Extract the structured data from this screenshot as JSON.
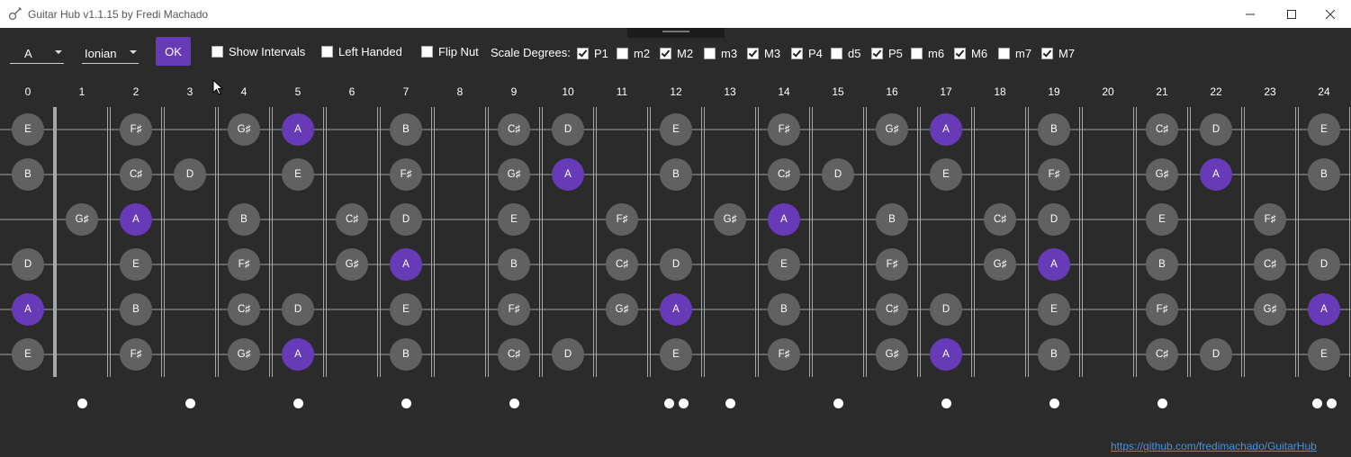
{
  "window": {
    "title": "Guitar Hub v1.1.15 by Fredi Machado"
  },
  "toolbar": {
    "key": "A",
    "mode": "Ionian",
    "ok_label": "OK",
    "show_intervals": {
      "label": "Show Intervals",
      "checked": false
    },
    "left_handed": {
      "label": "Left Handed",
      "checked": false
    },
    "flip_nut": {
      "label": "Flip Nut",
      "checked": false
    },
    "scale_degrees_label": "Scale Degrees:",
    "degrees": [
      {
        "label": "P1",
        "checked": true
      },
      {
        "label": "m2",
        "checked": false
      },
      {
        "label": "M2",
        "checked": true
      },
      {
        "label": "m3",
        "checked": false
      },
      {
        "label": "M3",
        "checked": true
      },
      {
        "label": "P4",
        "checked": true
      },
      {
        "label": "d5",
        "checked": false
      },
      {
        "label": "P5",
        "checked": true
      },
      {
        "label": "m6",
        "checked": false
      },
      {
        "label": "M6",
        "checked": true
      },
      {
        "label": "m7",
        "checked": false
      },
      {
        "label": "M7",
        "checked": true
      }
    ]
  },
  "fretboard": {
    "fret_numbers": [
      "0",
      "1",
      "2",
      "3",
      "4",
      "5",
      "6",
      "7",
      "8",
      "9",
      "10",
      "11",
      "12",
      "13",
      "14",
      "15",
      "16",
      "17",
      "18",
      "19",
      "20",
      "21",
      "22",
      "23",
      "24"
    ],
    "strings": [
      [
        "E",
        "",
        "F♯",
        "",
        "G♯",
        "A",
        "",
        "B",
        "",
        "C♯",
        "D",
        "",
        "E",
        "",
        "F♯",
        "",
        "G♯",
        "A",
        "",
        "B",
        "",
        "C♯",
        "D",
        "",
        "E"
      ],
      [
        "B",
        "",
        "C♯",
        "D",
        "",
        "E",
        "",
        "F♯",
        "",
        "G♯",
        "A",
        "",
        "B",
        "",
        "C♯",
        "D",
        "",
        "E",
        "",
        "F♯",
        "",
        "G♯",
        "A",
        "",
        "B"
      ],
      [
        "",
        "G♯",
        "A",
        "",
        "B",
        "",
        "C♯",
        "D",
        "",
        "E",
        "",
        "F♯",
        "",
        "G♯",
        "A",
        "",
        "B",
        "",
        "C♯",
        "D",
        "",
        "E",
        "",
        "F♯",
        ""
      ],
      [
        "D",
        "",
        "E",
        "",
        "F♯",
        "",
        "G♯",
        "A",
        "",
        "B",
        "",
        "C♯",
        "D",
        "",
        "E",
        "",
        "F♯",
        "",
        "G♯",
        "A",
        "",
        "B",
        "",
        "C♯",
        "D"
      ],
      [
        "A",
        "",
        "B",
        "",
        "C♯",
        "D",
        "",
        "E",
        "",
        "F♯",
        "",
        "G♯",
        "A",
        "",
        "B",
        "",
        "C♯",
        "D",
        "",
        "E",
        "",
        "F♯",
        "",
        "G♯",
        "A"
      ],
      [
        "E",
        "",
        "F♯",
        "",
        "G♯",
        "A",
        "",
        "B",
        "",
        "C♯",
        "D",
        "",
        "E",
        "",
        "F♯",
        "",
        "G♯",
        "A",
        "",
        "B",
        "",
        "C♯",
        "D",
        "",
        "E"
      ]
    ],
    "root_note": "A",
    "colors": {
      "root": "#673ab7",
      "note": "#616161"
    },
    "inlay_frets": [
      {
        "fret": 1,
        "dots": 1
      },
      {
        "fret": 3,
        "dots": 1
      },
      {
        "fret": 5,
        "dots": 1
      },
      {
        "fret": 7,
        "dots": 1
      },
      {
        "fret": 9,
        "dots": 1
      },
      {
        "fret": 12,
        "dots": 2
      },
      {
        "fret": 13,
        "dots": 1
      },
      {
        "fret": 15,
        "dots": 1
      },
      {
        "fret": 17,
        "dots": 1
      },
      {
        "fret": 19,
        "dots": 1
      },
      {
        "fret": 21,
        "dots": 1
      },
      {
        "fret": 24,
        "dots": 2
      }
    ]
  },
  "footer": {
    "link": "https://github.com/fredimachado/GuitarHub"
  }
}
